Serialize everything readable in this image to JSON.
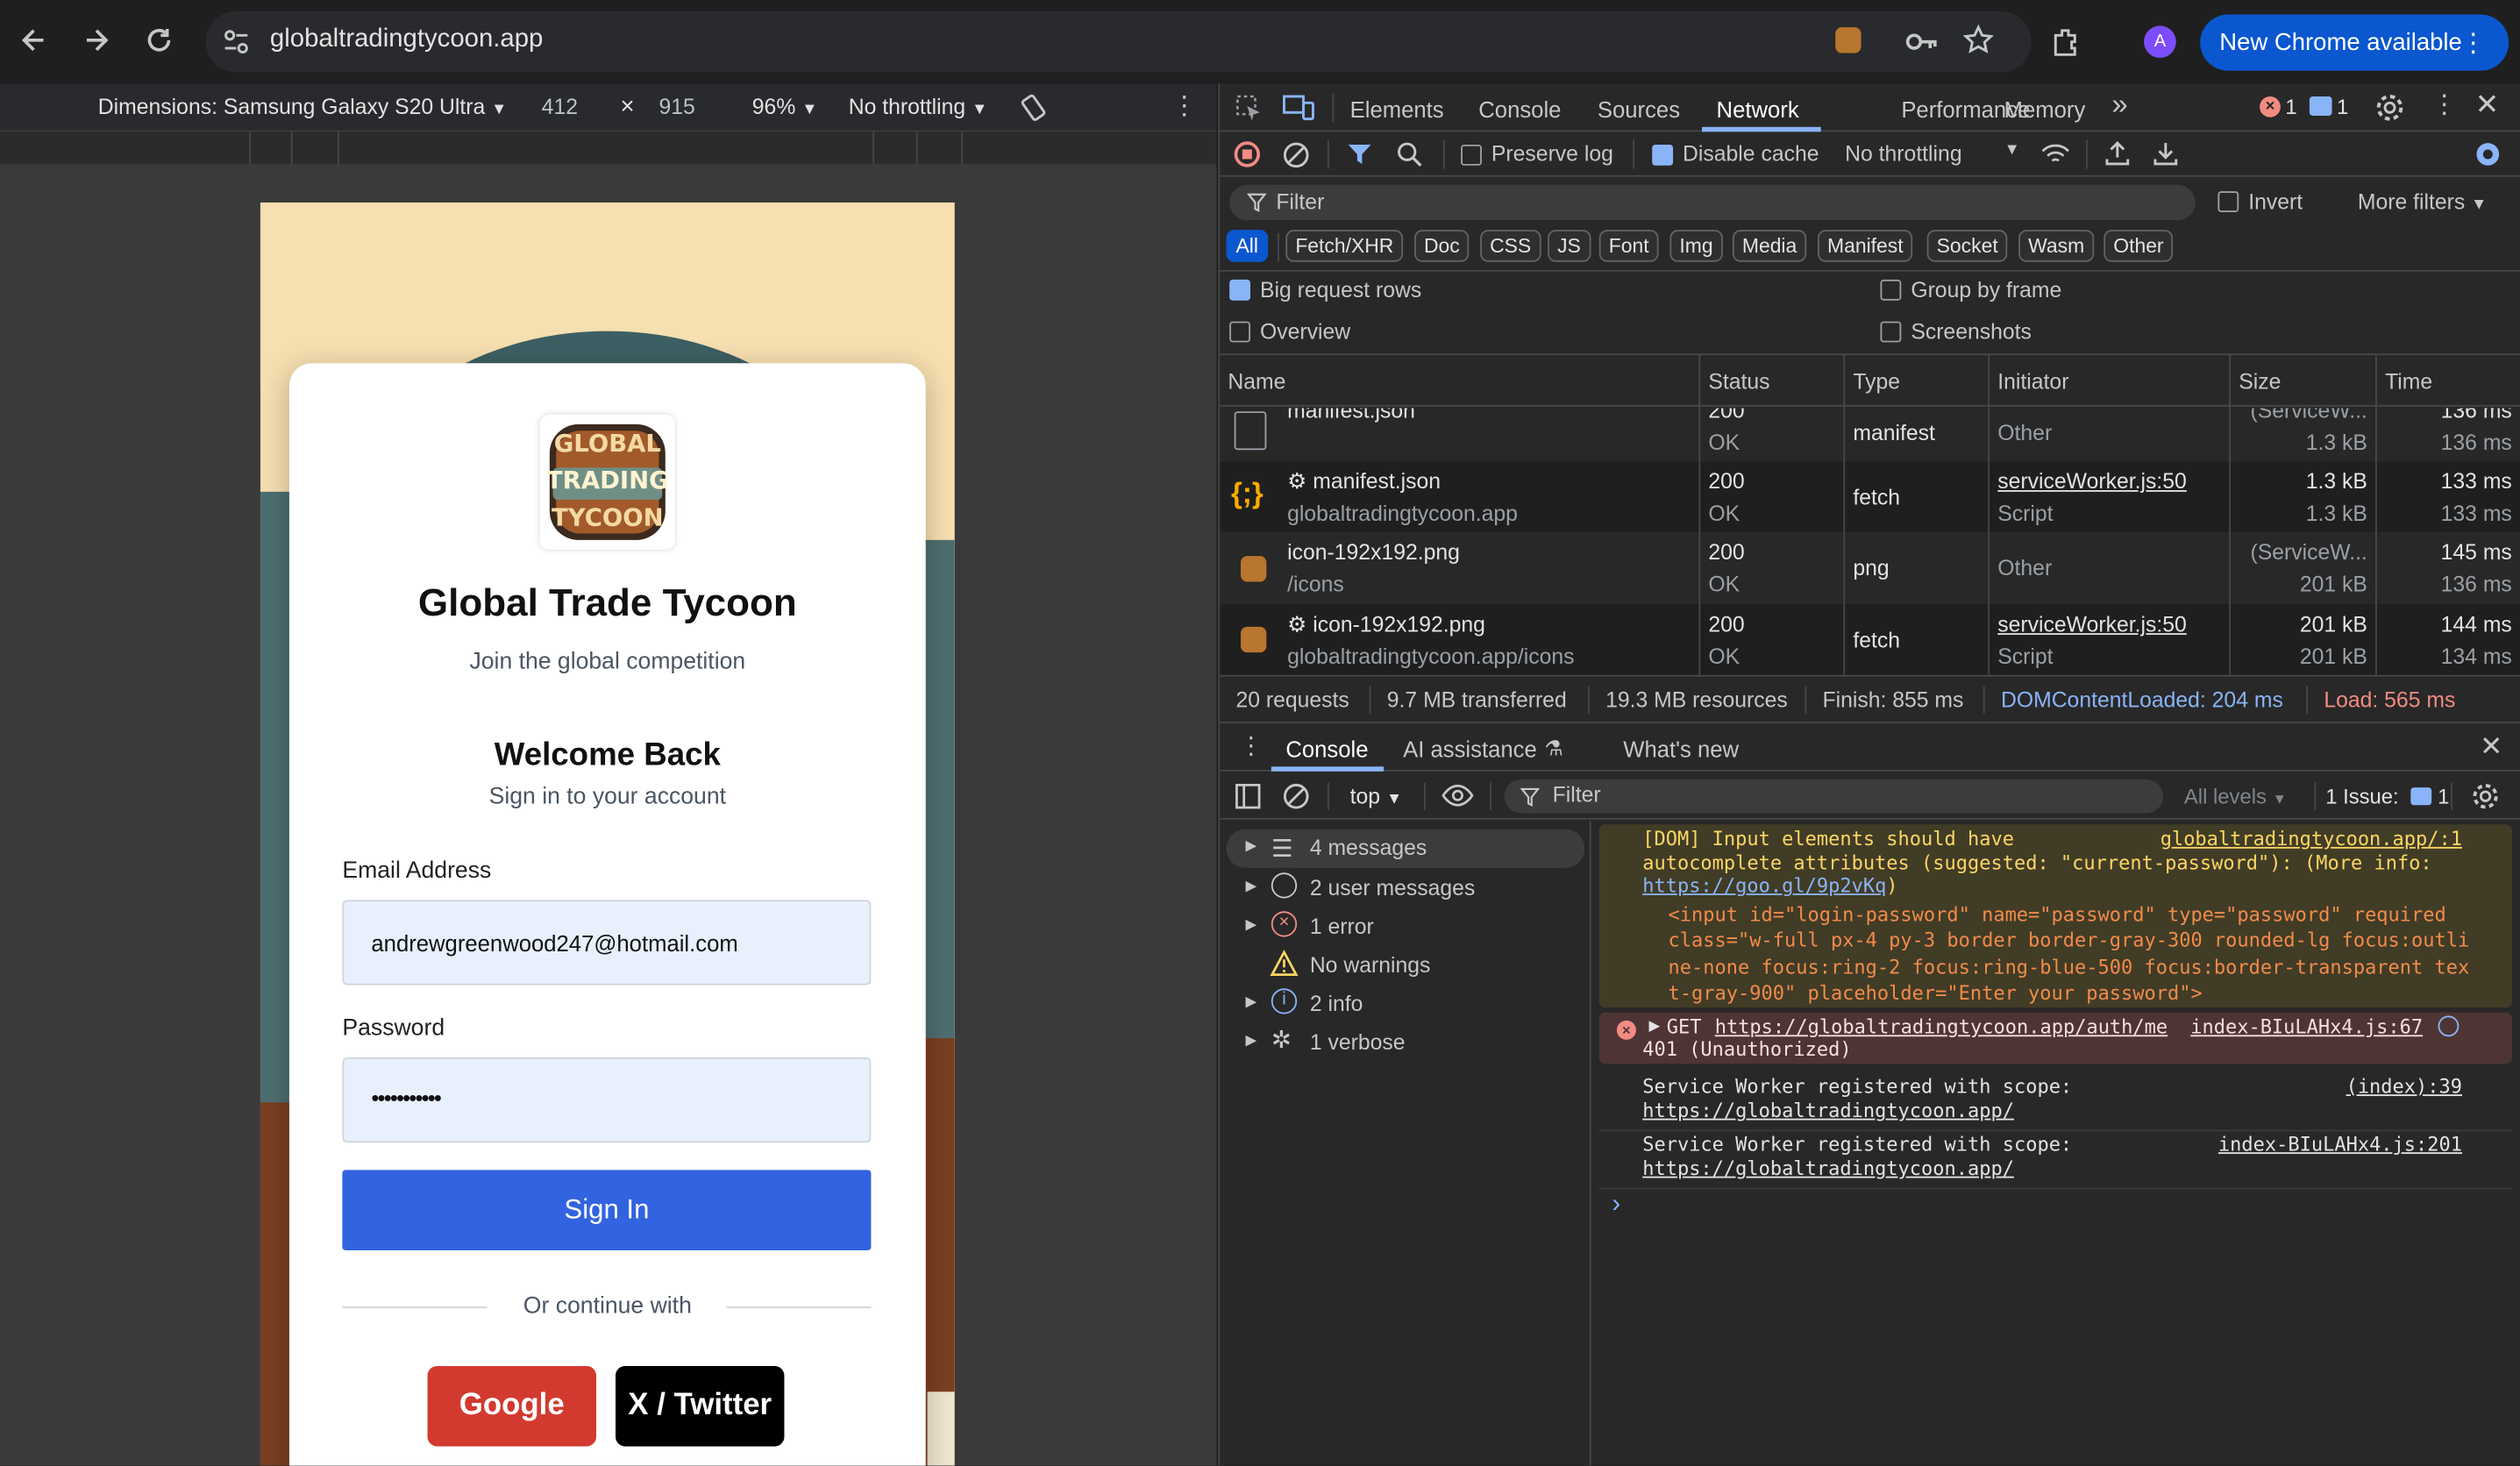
{
  "browser": {
    "url": "globaltradingtycoon.app",
    "new_chrome": "New Chrome available",
    "avatar": "A"
  },
  "device_toolbar": {
    "dimensions": "Dimensions: Samsung Galaxy S20 Ultra",
    "width": "412",
    "times": "×",
    "height": "915",
    "zoom": "96%",
    "throttle": "No throttling"
  },
  "app": {
    "logo_lines": [
      "GLOBAL",
      "TRADING",
      "TYCOON"
    ],
    "title": "Global Trade Tycoon",
    "subtitle": "Join the global competition",
    "welcome": "Welcome Back",
    "signin_hint": "Sign in to your account",
    "email_label": "Email Address",
    "email_value": "andrewgreenwood247@hotmail.com",
    "password_label": "Password",
    "password_value": "•••••••••••",
    "signin_button": "Sign In",
    "continue_with": "Or continue with",
    "google": "Google",
    "twitter": "X / Twitter"
  },
  "devtools": {
    "tabs": [
      "Elements",
      "Console",
      "Sources",
      "Network",
      "Performance",
      "Memory"
    ],
    "active_tab": "Network",
    "more_tabs": "»",
    "error_count": "1",
    "issue_count": "1",
    "network": {
      "preserve_log": "Preserve log",
      "disable_cache": "Disable cache",
      "throttle": "No throttling",
      "filter_placeholder": "Filter",
      "invert": "Invert",
      "more_filters": "More filters",
      "type_filters": [
        "All",
        "Fetch/XHR",
        "Doc",
        "CSS",
        "JS",
        "Font",
        "Img",
        "Media",
        "Manifest",
        "Socket",
        "Wasm",
        "Other"
      ],
      "big_rows": "Big request rows",
      "group_by_frame": "Group by frame",
      "overview": "Overview",
      "screenshots": "Screenshots",
      "columns": [
        "Name",
        "Status",
        "Type",
        "Initiator",
        "Size",
        "Time"
      ],
      "rows": [
        {
          "name": "manifest.json",
          "sub": "",
          "status": "200",
          "status_text": "OK",
          "type": "manifest",
          "initiator": "Other",
          "initiator_sub": "",
          "size": "(ServiceW...",
          "size_sub": "1.3 kB",
          "time": "136 ms",
          "time_sub": "136 ms"
        },
        {
          "name": "⚙ manifest.json",
          "sub": "globaltradingtycoon.app",
          "status": "200",
          "status_text": "OK",
          "type": "fetch",
          "initiator": "serviceWorker.js:50",
          "initiator_sub": "Script",
          "size": "1.3 kB",
          "size_sub": "1.3 kB",
          "time": "133 ms",
          "time_sub": "133 ms"
        },
        {
          "name": "icon-192x192.png",
          "sub": "/icons",
          "status": "200",
          "status_text": "OK",
          "type": "png",
          "initiator": "Other",
          "initiator_sub": "",
          "size": "(ServiceW...",
          "size_sub": "201 kB",
          "time": "145 ms",
          "time_sub": "136 ms"
        },
        {
          "name": "⚙ icon-192x192.png",
          "sub": "globaltradingtycoon.app/icons",
          "status": "200",
          "status_text": "OK",
          "type": "fetch",
          "initiator": "serviceWorker.js:50",
          "initiator_sub": "Script",
          "size": "201 kB",
          "size_sub": "201 kB",
          "time": "144 ms",
          "time_sub": "134 ms"
        }
      ],
      "summary": {
        "requests": "20 requests",
        "transferred": "9.7 MB transferred",
        "resources": "19.3 MB resources",
        "finish": "Finish: 855 ms",
        "dcl": "DOMContentLoaded: 204 ms",
        "load": "Load: 565 ms"
      }
    },
    "drawer": {
      "tabs": [
        "Console",
        "AI assistance",
        "What's new"
      ],
      "context": "top",
      "filter_placeholder": "Filter",
      "levels": "All levels",
      "issues": "1 Issue:",
      "issues_count": "1",
      "sidebar": [
        "4 messages",
        "2 user messages",
        "1 error",
        "No warnings",
        "2 info",
        "1 verbose"
      ],
      "messages": {
        "dom_warning_1": "[DOM] Input elements should have",
        "dom_warning_src": "globaltradingtycoon.app/:1",
        "dom_warning_2": "autocomplete attributes (suggested: \"current-password\"): (More info:",
        "dom_warning_link": "https://goo.gl/9p2vKq",
        "dom_warning_close": ")",
        "code_1": "<input id=\"login-password\" name=\"password\" type=\"password\" required",
        "code_2": "class=\"w-full px-4 py-3 border border-gray-300 rounded-lg focus:outli",
        "code_3": "ne-none focus:ring-2 focus:ring-blue-500 focus:border-transparent tex",
        "code_4": "t-gray-900\" placeholder=\"Enter your password\">",
        "err_method": "GET",
        "err_url": "https://globaltradingtycoon.app/auth/me",
        "err_src": "index-BIuLAHx4.js:67",
        "err_status": "401 (Unauthorized)",
        "sw1": "Service Worker registered with scope:",
        "sw1_src": "(index):39",
        "sw1_url": "https://globaltradingtycoon.app/",
        "sw2": "Service Worker registered with scope:",
        "sw2_src": "index-BIuLAHx4.js:201",
        "sw2_url": "https://globaltradingtycoon.app/",
        "prompt": "›"
      }
    }
  }
}
